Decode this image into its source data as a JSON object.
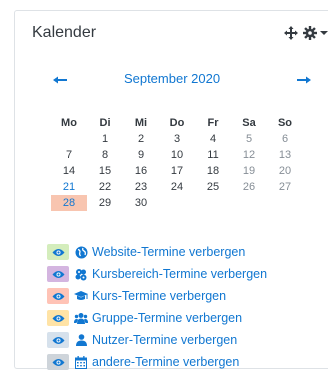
{
  "block": {
    "title": "Kalender"
  },
  "calendar": {
    "month_label": "September 2020",
    "weekdays": [
      "Mo",
      "Di",
      "Mi",
      "Do",
      "Fr",
      "Sa",
      "So"
    ],
    "weeks": [
      [
        "",
        "1",
        "2",
        "3",
        "4",
        "5",
        "6"
      ],
      [
        "7",
        "8",
        "9",
        "10",
        "11",
        "12",
        "13"
      ],
      [
        "14",
        "15",
        "16",
        "17",
        "18",
        "19",
        "20"
      ],
      [
        "21",
        "22",
        "23",
        "24",
        "25",
        "26",
        "27"
      ],
      [
        "28",
        "29",
        "30",
        "",
        "",
        "",
        ""
      ]
    ],
    "today": "28",
    "linked_day": "21"
  },
  "filters": [
    {
      "label": "Website-Termine verbergen",
      "badge_color": "#d4edbc",
      "icon": "globe-icon"
    },
    {
      "label": "Kursbereich-Termine verbergen",
      "badge_color": "#d4b5e0",
      "icon": "category-icon"
    },
    {
      "label": "Kurs-Termine verbergen",
      "badge_color": "#ffc3b6",
      "icon": "graduation-cap-icon"
    },
    {
      "label": "Gruppe-Termine verbergen",
      "badge_color": "#ffe3a6",
      "icon": "group-icon"
    },
    {
      "label": "Nutzer-Termine verbergen",
      "badge_color": "#d6e1ec",
      "icon": "user-icon"
    },
    {
      "label": "andere-Termine verbergen",
      "badge_color": "#ced4da",
      "icon": "calendar-icon"
    }
  ]
}
